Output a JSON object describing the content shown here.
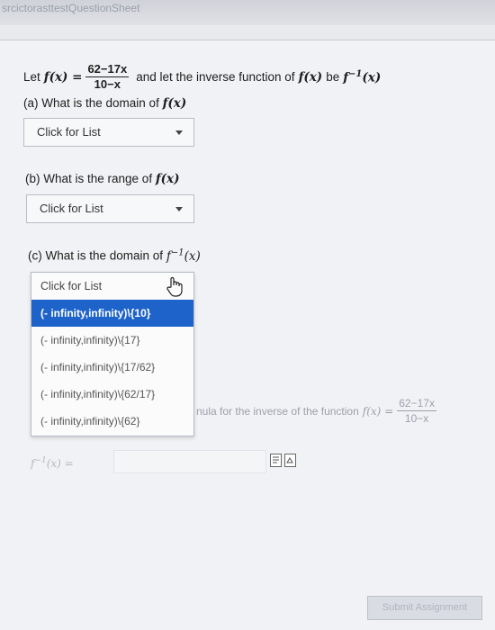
{
  "header": {
    "title": "srcictorasttestQuestionSheet"
  },
  "question": {
    "intro_let": "Let",
    "function_name": "f(x) =",
    "fraction": {
      "numerator": "62−17x",
      "denominator": "10−x"
    },
    "intro_rest": "and let the inverse function of",
    "intro_fx": "f(x)",
    "intro_be": "be",
    "inverse_name": "f",
    "inverse_exp": "−1",
    "inverse_arg": "(x)"
  },
  "part_a": {
    "label": "(a) What is the domain of",
    "fx": "f(x)",
    "select_value": "Click for List"
  },
  "part_b": {
    "label": "(b) What is the range of",
    "fx": "f(x)",
    "select_value": "Click for List"
  },
  "part_c": {
    "label": "(c) What is the domain of",
    "finv": "f",
    "finv_exp": "−1",
    "finv_arg": "(x)",
    "select_value": "Click for List",
    "options": [
      "(- infinity,infinity)\\{10}",
      "(- infinity,infinity)\\{17}",
      "(- infinity,infinity)\\{17/62}",
      "(- infinity,infinity)\\{62/17}",
      "(- infinity,infinity)\\{62}"
    ]
  },
  "part_d": {
    "label_partial": "nula for the inverse of the function",
    "fx": "f(x) =",
    "fraction": {
      "numerator": "62−17x",
      "denominator": "10−x"
    },
    "answer_prefix": "f",
    "answer_exp": "−1",
    "answer_arg": "(x) ="
  },
  "footer": {
    "submit_label": "Submit Assignment"
  },
  "colors": {
    "selected_option": "#1d63c9",
    "background": "#f1f2f5"
  }
}
